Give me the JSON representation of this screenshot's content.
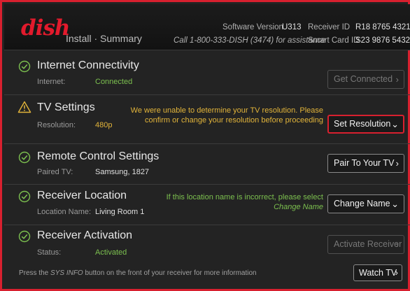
{
  "header": {
    "logo": "dish",
    "title": "Install · Summary",
    "software_version_label": "Software Version",
    "software_version": "U313",
    "receiver_id_label": "Receiver ID",
    "receiver_id": "R18 8765 4321",
    "assistance": "Call 1-800-333-DISH (3474) for assistance",
    "smart_card_label": "Smart Card ID",
    "smart_card_id": "S23 9876 5432"
  },
  "rows": [
    {
      "icon": "check-circle-icon",
      "title": "Internet Connectivity",
      "label": "Internet:",
      "value": "Connected",
      "button": "Get Connected"
    },
    {
      "icon": "warning-icon",
      "title": "TV Settings",
      "label": "Resolution:",
      "value": "480p",
      "message_line1": "We were unable to determine your TV resolution. Please",
      "message_line2": "confirm or change your resolution before proceeding",
      "button": "Set Resolution"
    },
    {
      "icon": "check-circle-icon",
      "title": "Remote Control Settings",
      "label": "Paired TV:",
      "value": "Samsung, 1827",
      "button": "Pair To Your TV"
    },
    {
      "icon": "check-circle-icon",
      "title": "Receiver Location",
      "label": "Location Name:",
      "value": "Living Room 1",
      "message_line1": "If this location name is incorrect, please select",
      "message_line2": "Change Name",
      "button": "Change Name"
    },
    {
      "icon": "check-circle-icon",
      "title": "Receiver Activation",
      "label": "Status:",
      "value": "Activated",
      "button": "Activate Receiver"
    }
  ],
  "footer": {
    "note_prefix": "Press the ",
    "note_emph": "SYS INFO",
    "note_suffix": " button on the front of your receiver for more information",
    "watch_button": "Watch TV"
  },
  "colors": {
    "brand_red": "#d8202f",
    "ok_green": "#7cc04f",
    "warning_yellow": "#e2b43a"
  }
}
